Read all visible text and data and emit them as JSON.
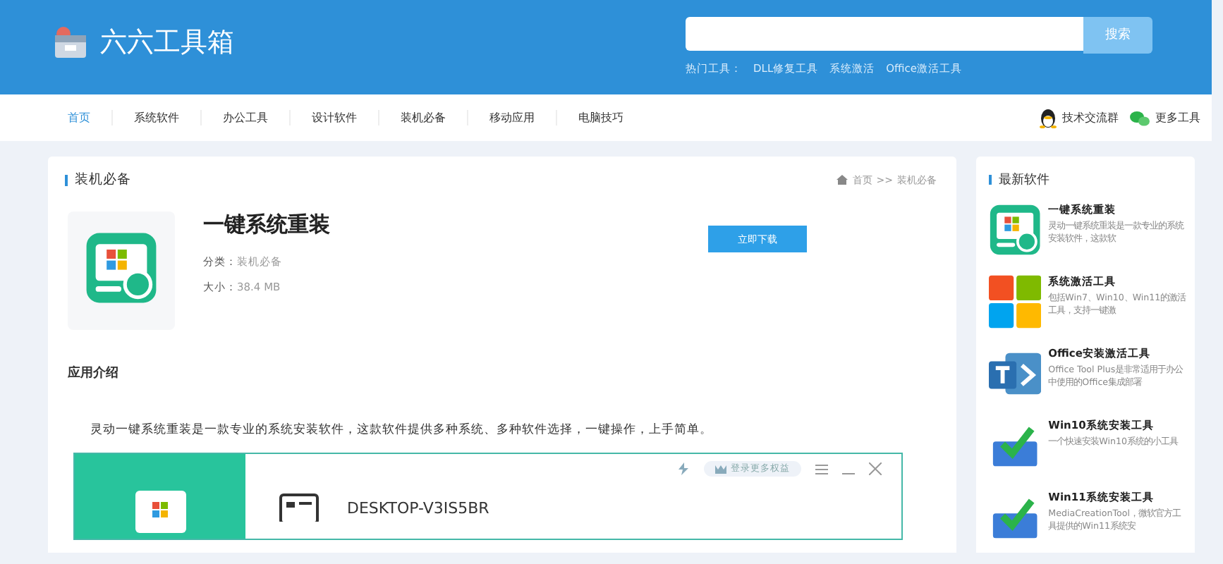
{
  "header": {
    "logo": "六六工具箱",
    "search": {
      "button": "搜索"
    },
    "hot_label": "热门工具：",
    "hot_links": [
      "DLL修复工具",
      "系统激活",
      "Office激活工具"
    ]
  },
  "nav": {
    "items": [
      {
        "label": "首页",
        "selected": true
      },
      {
        "label": "系统软件",
        "selected": false
      },
      {
        "label": "办公工具",
        "selected": false
      },
      {
        "label": "设计软件",
        "selected": false
      },
      {
        "label": "装机必备",
        "selected": false
      },
      {
        "label": "移动应用",
        "selected": false
      },
      {
        "label": "电脑技巧",
        "selected": false
      }
    ],
    "right_links": [
      {
        "kind": "penguin",
        "label": "技术交流群"
      },
      {
        "kind": "chat",
        "label": "更多工具"
      }
    ]
  },
  "main": {
    "section_title": "装机必备",
    "breadcrumb": [
      "首页",
      ">>",
      "装机必备"
    ],
    "app": {
      "name": "一键系统重装",
      "category_label": "分类：",
      "category": "装机必备",
      "size_label": "大小：",
      "size": "38.4 MB",
      "download": "立即下载"
    },
    "intro_title": "应用介绍",
    "intro_text": "灵动一键系统重装是一款专业的系统安装软件，这款软件提供多种系统、多种软件选择，一键操作，上手简单。",
    "screenshot": {
      "login": "登录更多权益",
      "computer_name": "DESKTOP-V3IS5BR"
    }
  },
  "sidebar": {
    "title": "最新软件",
    "items": [
      {
        "kind": "reinstall",
        "name": "一键系统重装",
        "desc": "灵动一键系统重装是一款专业的系统安装软件，这款软"
      },
      {
        "kind": "windows",
        "name": "系统激活工具",
        "desc": "包括Win7、Win10、Win11的激活工具，支持一键激"
      },
      {
        "kind": "office",
        "name": "Office安装激活工具",
        "desc": "Office Tool Plus是非常适用于办公中使用的Office集成部署"
      },
      {
        "kind": "installer",
        "name": "Win10系统安装工具",
        "desc": "一个快速安装Win10系统的小工具"
      },
      {
        "kind": "installer",
        "name": "Win11系统安装工具",
        "desc": "MediaCreationTool，微软官方工具提供的Win11系统安"
      }
    ]
  }
}
